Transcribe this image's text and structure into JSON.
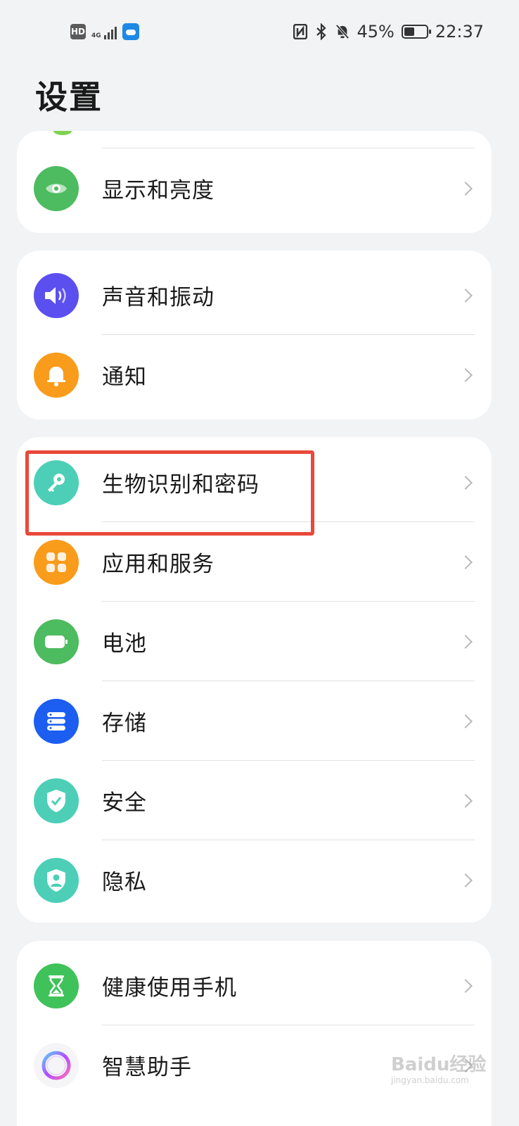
{
  "status_bar": {
    "hd": "HD",
    "network": "4G",
    "battery_percent": "45%",
    "battery_level": 0.45,
    "time": "22:37"
  },
  "page_title": "设置",
  "sections": [
    {
      "items": [
        {
          "label": "显示和亮度",
          "icon": "eye-icon",
          "color": "#4dbb5f"
        }
      ]
    },
    {
      "items": [
        {
          "label": "声音和振动",
          "icon": "speaker-icon",
          "color": "#5b4ff0"
        },
        {
          "label": "通知",
          "icon": "bell-icon",
          "color": "#f99c1c"
        }
      ]
    },
    {
      "items": [
        {
          "label": "生物识别和密码",
          "icon": "key-icon",
          "color": "#4ccfb6"
        },
        {
          "label": "应用和服务",
          "icon": "apps-grid-icon",
          "color": "#f99c1c"
        },
        {
          "label": "电池",
          "icon": "battery-icon",
          "color": "#4dbb5f"
        },
        {
          "label": "存储",
          "icon": "storage-icon",
          "color": "#1b5ef0"
        },
        {
          "label": "安全",
          "icon": "shield-check-icon",
          "color": "#4ccfb6"
        },
        {
          "label": "隐私",
          "icon": "privacy-shield-icon",
          "color": "#4ccfb6"
        }
      ]
    },
    {
      "items": [
        {
          "label": "健康使用手机",
          "icon": "hourglass-icon",
          "color": "#3fc25a"
        },
        {
          "label": "智慧助手",
          "icon": "assistant-ring-icon",
          "color": "#f5f5f7"
        }
      ]
    }
  ],
  "watermark": {
    "text": "Baidu经验",
    "sub": "jingyan.baidu.com"
  }
}
